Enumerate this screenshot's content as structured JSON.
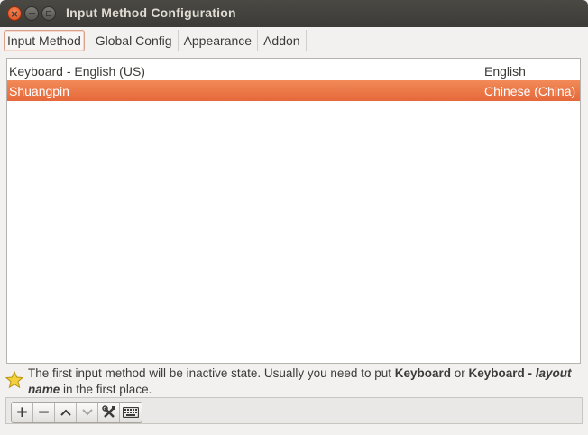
{
  "window": {
    "title": "Input Method Configuration"
  },
  "tabs": [
    {
      "label": "Input Method",
      "active": true
    },
    {
      "label": "Global Config",
      "active": false
    },
    {
      "label": "Appearance",
      "active": false
    },
    {
      "label": "Addon",
      "active": false
    }
  ],
  "input_methods": {
    "rows": [
      {
        "name": "Keyboard - English (US)",
        "language": "English",
        "selected": false
      },
      {
        "name": "Shuangpin",
        "language": "Chinese (China)",
        "selected": true
      }
    ]
  },
  "hint": {
    "part1": "The first input method will be inactive state. Usually you need to put ",
    "bold1": "Keyboard",
    "part2": " or ",
    "bold2": "Keyboard - ",
    "italic": "layout name",
    "part3": " in the first place.",
    "icon": "star-icon"
  },
  "toolbar": {
    "buttons": [
      {
        "name": "add-button",
        "icon": "plus-icon",
        "glyph": "+",
        "enabled": true
      },
      {
        "name": "remove-button",
        "icon": "minus-icon",
        "glyph": "−",
        "enabled": true
      },
      {
        "name": "move-up-button",
        "icon": "chevron-up-icon",
        "enabled": true
      },
      {
        "name": "move-down-button",
        "icon": "chevron-down-icon",
        "enabled": false
      },
      {
        "name": "configure-button",
        "icon": "tools-icon",
        "enabled": true
      },
      {
        "name": "keyboard-layout-button",
        "icon": "keyboard-icon",
        "enabled": true
      }
    ]
  },
  "colors": {
    "selection": "#e9703f",
    "titlebar": "#3c3b37",
    "close": "#df4a16"
  }
}
